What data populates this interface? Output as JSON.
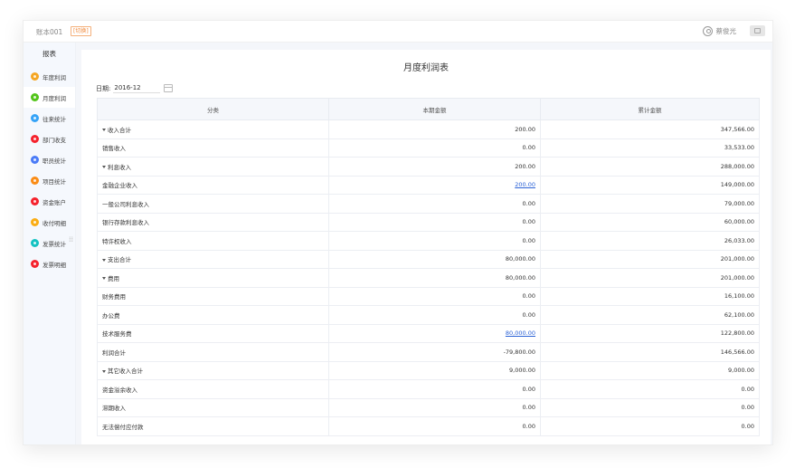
{
  "header": {
    "account_name": "账本001",
    "switch_label": "[切换]",
    "user_name": "蔡俊光"
  },
  "sidebar": {
    "title": "报表",
    "items": [
      {
        "label": "年度利润",
        "icon": "profit-icon",
        "color": "#f5a623",
        "active": false
      },
      {
        "label": "月度利润",
        "icon": "monthly-profit-icon",
        "color": "#52c41a",
        "active": true
      },
      {
        "label": "往来统计",
        "icon": "transaction-icon",
        "color": "#36a3f7",
        "active": false
      },
      {
        "label": "部门收支",
        "icon": "department-icon",
        "color": "#f5222d",
        "active": false
      },
      {
        "label": "职员统计",
        "icon": "staff-icon",
        "color": "#4a7bf7",
        "active": false
      },
      {
        "label": "项目统计",
        "icon": "project-icon",
        "color": "#fa8c16",
        "active": false
      },
      {
        "label": "资金账户",
        "icon": "fund-account-icon",
        "color": "#f5222d",
        "active": false
      },
      {
        "label": "收付明细",
        "icon": "payment-icon",
        "color": "#faad14",
        "active": false
      },
      {
        "label": "发票统计",
        "icon": "invoice-stat-icon",
        "color": "#13c2c2",
        "active": false
      },
      {
        "label": "发票明细",
        "icon": "invoice-detail-icon",
        "color": "#f5222d",
        "active": false
      }
    ]
  },
  "report": {
    "title": "月度利润表",
    "date_label": "日期:",
    "date_value": "2016-12",
    "columns": [
      "分类",
      "本期金额",
      "累计金额"
    ],
    "rows": [
      {
        "name": "收入合计",
        "level": 0,
        "caret": true,
        "current": "200.00",
        "cumulative": "347,566.00",
        "link": false
      },
      {
        "name": "销售收入",
        "level": 2,
        "caret": false,
        "current": "0.00",
        "cumulative": "33,533.00",
        "link": false
      },
      {
        "name": "利息收入",
        "level": 1,
        "caret": true,
        "current": "200.00",
        "cumulative": "288,000.00",
        "link": false
      },
      {
        "name": "金融企业收入",
        "level": 2,
        "caret": false,
        "current": "200.00",
        "cumulative": "149,000.00",
        "link": true
      },
      {
        "name": "一般公司利息收入",
        "level": 2,
        "caret": false,
        "current": "0.00",
        "cumulative": "79,000.00",
        "link": false
      },
      {
        "name": "银行存款利息收入",
        "level": 2,
        "caret": false,
        "current": "0.00",
        "cumulative": "60,000.00",
        "link": false
      },
      {
        "name": "特许权收入",
        "level": 1,
        "caret": false,
        "current": "0.00",
        "cumulative": "26,033.00",
        "link": false
      },
      {
        "name": "支出合计",
        "level": 0,
        "caret": true,
        "current": "80,000.00",
        "cumulative": "201,000.00",
        "link": false
      },
      {
        "name": "费用",
        "level": 1,
        "caret": true,
        "current": "80,000.00",
        "cumulative": "201,000.00",
        "link": false
      },
      {
        "name": "财务费用",
        "level": 2,
        "caret": false,
        "current": "0.00",
        "cumulative": "16,100.00",
        "link": false
      },
      {
        "name": "办公费",
        "level": 2,
        "caret": false,
        "current": "0.00",
        "cumulative": "62,100.00",
        "link": false
      },
      {
        "name": "技术服务费",
        "level": 2,
        "caret": false,
        "current": "80,000.00",
        "cumulative": "122,800.00",
        "link": true
      },
      {
        "name": "利润合计",
        "level": 1,
        "caret": false,
        "current": "-79,800.00",
        "cumulative": "146,566.00",
        "link": false
      },
      {
        "name": "其它收入合计",
        "level": 0,
        "caret": true,
        "current": "9,000.00",
        "cumulative": "9,000.00",
        "link": false
      },
      {
        "name": "资金溢余收入",
        "level": 1,
        "caret": false,
        "current": "0.00",
        "cumulative": "0.00",
        "link": false
      },
      {
        "name": "滞期收入",
        "level": 1,
        "caret": false,
        "current": "0.00",
        "cumulative": "0.00",
        "link": false
      },
      {
        "name": "无法偿付应付款",
        "level": 1,
        "caret": false,
        "current": "0.00",
        "cumulative": "0.00",
        "link": false
      }
    ]
  }
}
